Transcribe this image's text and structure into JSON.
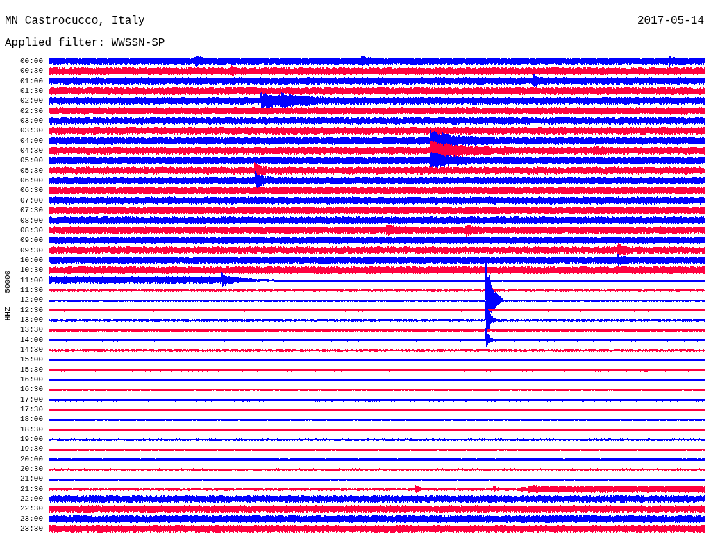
{
  "title": "MN Castrocucco, Italy",
  "date": "2017-05-14",
  "filter": "Applied filter: WWSSN-SP",
  "axis_label": "HHZ - 50000",
  "rows": [
    {
      "time": "00:00",
      "color": "#0000ff"
    },
    {
      "time": "00:30",
      "color": "#ff0040"
    },
    {
      "time": "01:00",
      "color": "#0000ff"
    },
    {
      "time": "01:30",
      "color": "#ff0040"
    },
    {
      "time": "02:00",
      "color": "#0000ff"
    },
    {
      "time": "02:30",
      "color": "#ff0040"
    },
    {
      "time": "03:00",
      "color": "#0000ff"
    },
    {
      "time": "03:30",
      "color": "#ff0040"
    },
    {
      "time": "04:00",
      "color": "#0000ff"
    },
    {
      "time": "04:30",
      "color": "#ff0040"
    },
    {
      "time": "05:00",
      "color": "#0000ff"
    },
    {
      "time": "05:30",
      "color": "#ff0040"
    },
    {
      "time": "06:00",
      "color": "#0000ff"
    },
    {
      "time": "06:30",
      "color": "#ff0040"
    },
    {
      "time": "07:00",
      "color": "#0000ff"
    },
    {
      "time": "07:30",
      "color": "#ff0040"
    },
    {
      "time": "08:00",
      "color": "#0000ff"
    },
    {
      "time": "08:30",
      "color": "#ff0040"
    },
    {
      "time": "09:00",
      "color": "#0000ff"
    },
    {
      "time": "09:30",
      "color": "#ff0040"
    },
    {
      "time": "10:00",
      "color": "#0000ff"
    },
    {
      "time": "10:30",
      "color": "#ff0040"
    },
    {
      "time": "11:00",
      "color": "#0000ff"
    },
    {
      "time": "11:30",
      "color": "#ff0040"
    },
    {
      "time": "12:00",
      "color": "#0000ff"
    },
    {
      "time": "12:30",
      "color": "#ff0040"
    },
    {
      "time": "13:00",
      "color": "#0000ff"
    },
    {
      "time": "13:30",
      "color": "#ff0040"
    },
    {
      "time": "14:00",
      "color": "#0000ff"
    },
    {
      "time": "14:30",
      "color": "#ff0040"
    },
    {
      "time": "15:00",
      "color": "#0000ff"
    },
    {
      "time": "15:30",
      "color": "#ff0040"
    },
    {
      "time": "16:00",
      "color": "#0000ff"
    },
    {
      "time": "16:30",
      "color": "#ff0040"
    },
    {
      "time": "17:00",
      "color": "#0000ff"
    },
    {
      "time": "17:30",
      "color": "#ff0040"
    },
    {
      "time": "18:00",
      "color": "#0000ff"
    },
    {
      "time": "18:30",
      "color": "#ff0040"
    },
    {
      "time": "19:00",
      "color": "#0000ff"
    },
    {
      "time": "19:30",
      "color": "#ff0040"
    },
    {
      "time": "20:00",
      "color": "#0000ff"
    },
    {
      "time": "20:30",
      "color": "#ff0040"
    },
    {
      "time": "21:00",
      "color": "#0000ff"
    },
    {
      "time": "21:30",
      "color": "#ff0040"
    },
    {
      "time": "22:00",
      "color": "#0000ff"
    },
    {
      "time": "22:30",
      "color": "#ff0040"
    },
    {
      "time": "23:00",
      "color": "#0000ff"
    },
    {
      "time": "23:30",
      "color": "#ff0040"
    }
  ]
}
